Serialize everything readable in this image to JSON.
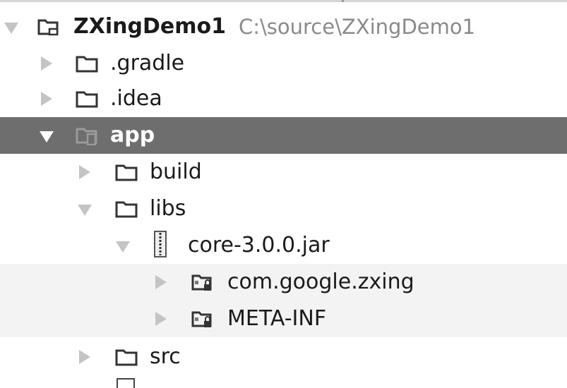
{
  "tree": {
    "project": {
      "name": "ZXingDemo1",
      "path": "C:\\source\\ZXingDemo1"
    },
    "items": [
      {
        "label": ".gradle"
      },
      {
        "label": ".idea"
      },
      {
        "label": "app"
      },
      {
        "label": "build"
      },
      {
        "label": "libs"
      },
      {
        "label": "core-3.0.0.jar"
      },
      {
        "label": "com.google.zxing"
      },
      {
        "label": "META-INF"
      },
      {
        "label": "src"
      }
    ]
  },
  "colors": {
    "selection": "#6e6e6e",
    "band": "#f3f3f3",
    "path_text": "#8a8a8a",
    "arrow": "#c4c4c4"
  },
  "icons": [
    "project-icon",
    "folder-icon",
    "module-icon",
    "jar-icon",
    "package-locked-icon"
  ]
}
